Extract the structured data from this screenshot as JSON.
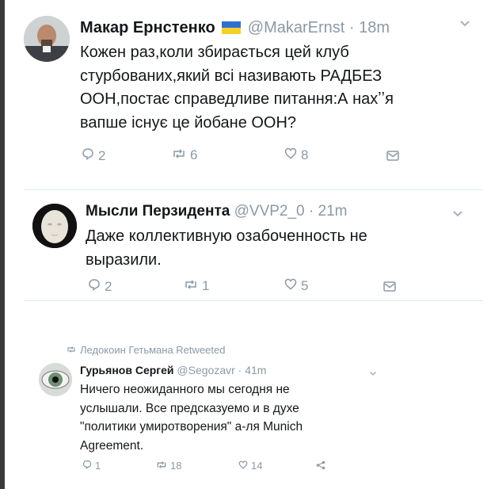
{
  "tweets": [
    {
      "name": "Макар Ернстенко",
      "flag": "🇺🇦",
      "handle": "@MakarErnst",
      "time": "· 18m",
      "lines": [
        "Кожен раз,коли збирається цей клуб",
        "стурбованих,який всі називають РАДБЕЗ",
        "ООН,постає справедливе питання:А нахʼʼя",
        "вапше існує це йобане ООН?"
      ],
      "replies": "2",
      "retweets": "6",
      "likes": "8"
    },
    {
      "name": "Мысли Перзидента",
      "handle": "@VVP2_0",
      "time": "· 21m",
      "lines": [
        "Даже коллективную озабоченность не",
        "выразили."
      ],
      "replies": "2",
      "retweets": "1",
      "likes": "5"
    },
    {
      "retweeted_by": "Ледокоин Гетьмана Retweeted",
      "name": "Гурьянов Сергей",
      "handle": "@Segozavr",
      "time": "· 41m",
      "lines": [
        "Ничего неожиданного мы сегодня не",
        "услышали. Все предсказуемо и в духе",
        "\"политики умиротворения\" а-ля Munich",
        "Agreement."
      ],
      "replies": "1",
      "retweets": "18",
      "likes": "14"
    }
  ],
  "colors": {
    "muted": "#8c99a5",
    "text": "#14171a",
    "divider": "#e1e8ed",
    "flag_blue": "#2f6fd0",
    "flag_yellow": "#f4d02a"
  },
  "icons": [
    "reply-icon",
    "retweet-icon",
    "like-icon",
    "message-icon",
    "share-icon",
    "chevron-down-icon"
  ]
}
